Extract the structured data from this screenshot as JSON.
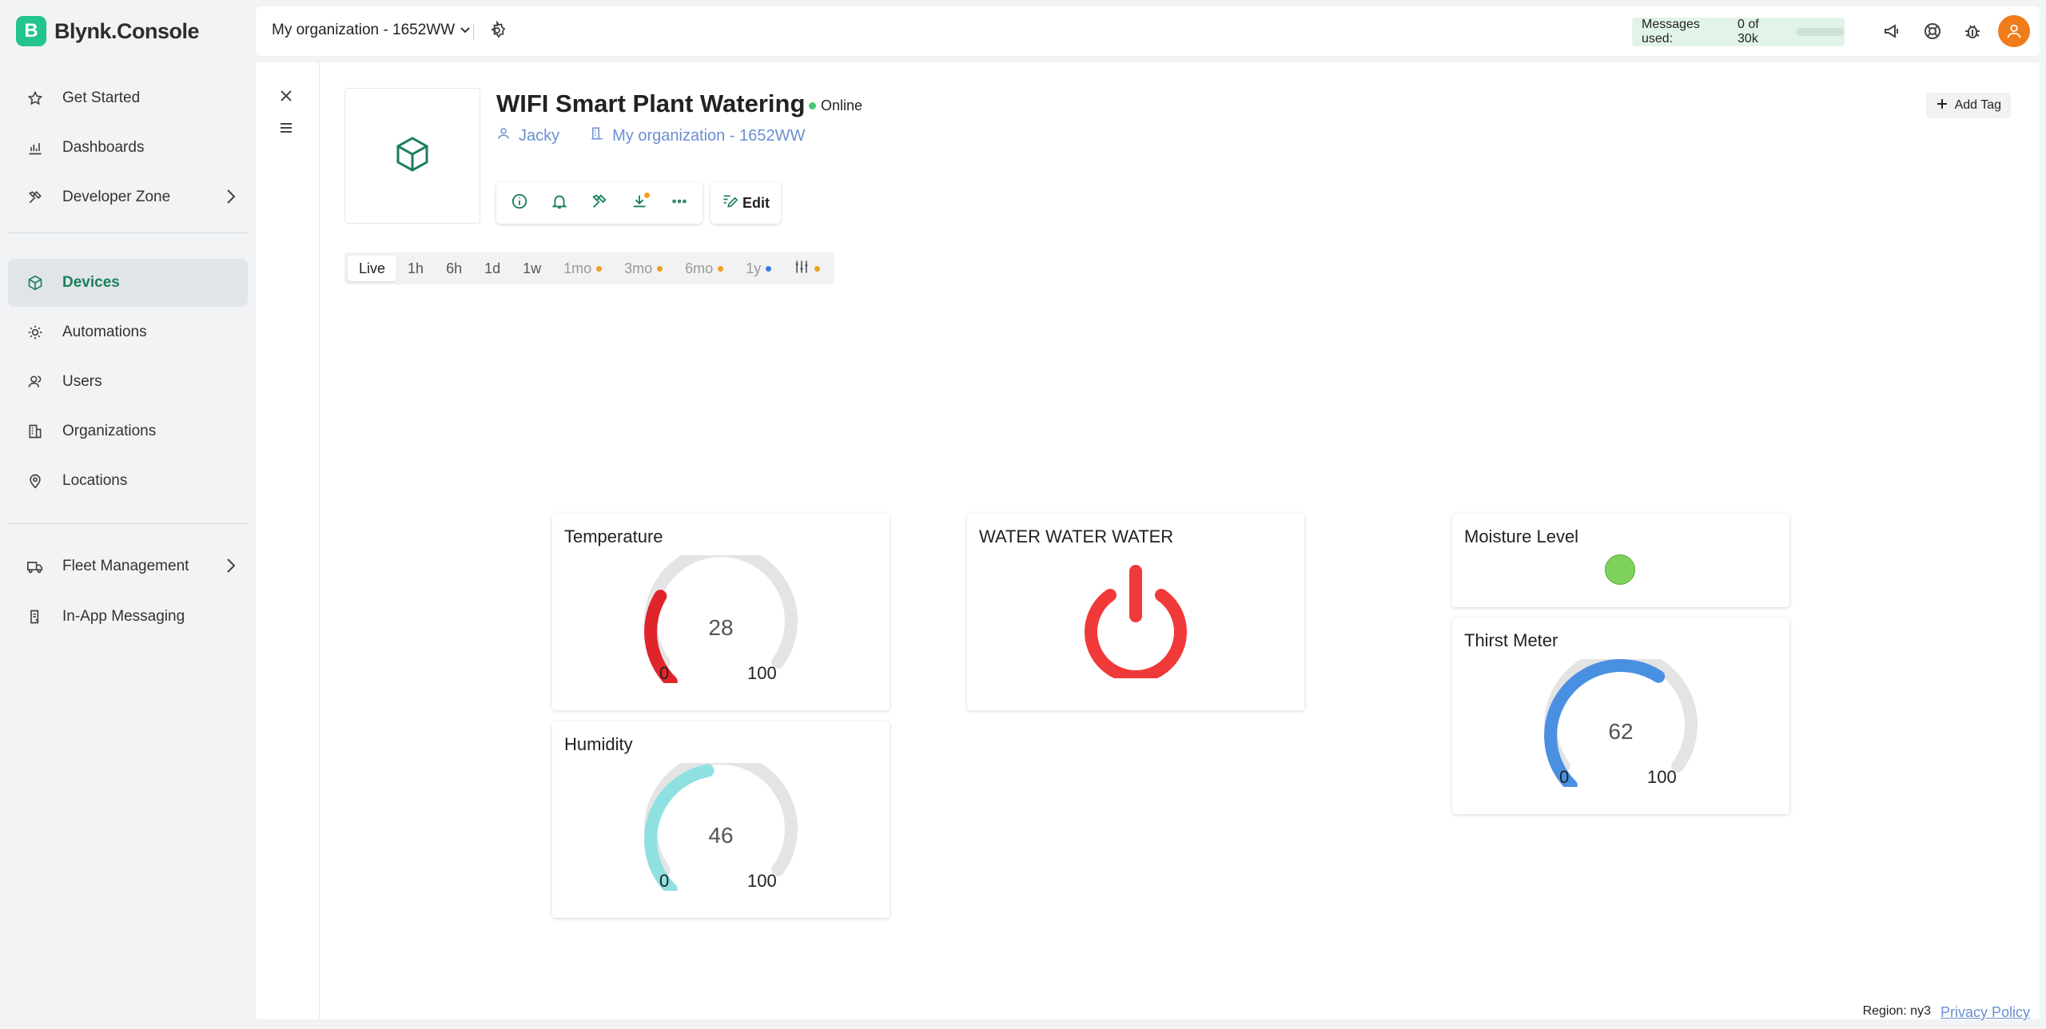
{
  "app": {
    "logo_letter": "B",
    "name": "Blynk.Console",
    "accent": "#23c48e"
  },
  "sidebar": {
    "items": [
      {
        "label": "Get Started",
        "icon": "star-icon"
      },
      {
        "label": "Dashboards",
        "icon": "bar-chart-icon"
      },
      {
        "label": "Developer Zone",
        "icon": "tools-icon"
      },
      {
        "label": "Devices",
        "icon": "cube-icon"
      },
      {
        "label": "Automations",
        "icon": "sun-icon"
      },
      {
        "label": "Users",
        "icon": "users-icon"
      },
      {
        "label": "Organizations",
        "icon": "building-icon"
      },
      {
        "label": "Locations",
        "icon": "pin-icon"
      },
      {
        "label": "Fleet Management",
        "icon": "truck-icon"
      },
      {
        "label": "In-App Messaging",
        "icon": "message-icon"
      }
    ],
    "active": "Devices"
  },
  "header": {
    "org": "My organization - 1652WW",
    "messages_used": "Messages used:",
    "messages_count": "0 of 30k"
  },
  "device": {
    "name": "WIFI Smart Plant Watering",
    "status": "Online",
    "owner": "Jacky",
    "org": "My organization - 1652WW",
    "edit_label": "Edit",
    "add_tag_label": "Add Tag"
  },
  "time_ranges": [
    {
      "label": "Live",
      "dot": null
    },
    {
      "label": "1h",
      "dot": null
    },
    {
      "label": "6h",
      "dot": null
    },
    {
      "label": "1d",
      "dot": null
    },
    {
      "label": "1w",
      "dot": null
    },
    {
      "label": "1mo",
      "dot": "#f0a020"
    },
    {
      "label": "3mo",
      "dot": "#f0a020"
    },
    {
      "label": "6mo",
      "dot": "#f0a020"
    },
    {
      "label": "1y",
      "dot": "#3d7be0"
    },
    {
      "label": "",
      "dot": "#f0a020"
    }
  ],
  "widgets": {
    "temperature": {
      "title": "Temperature",
      "value": 28,
      "min": "0",
      "max": "100",
      "color": "#e0242c"
    },
    "humidity": {
      "title": "Humidity",
      "value": 46,
      "min": "0",
      "max": "100",
      "color": "#8fe0e0"
    },
    "water": {
      "title": "WATER WATER WATER",
      "color": "#f03a3a"
    },
    "moisture": {
      "title": "Moisture Level",
      "color": "#7ed15a"
    },
    "thirst": {
      "title": "Thirst Meter",
      "value": 62,
      "min": "0",
      "max": "100",
      "color": "#4a90e2"
    }
  },
  "footer": {
    "region": "Region: ny3",
    "privacy": "Privacy Policy"
  }
}
